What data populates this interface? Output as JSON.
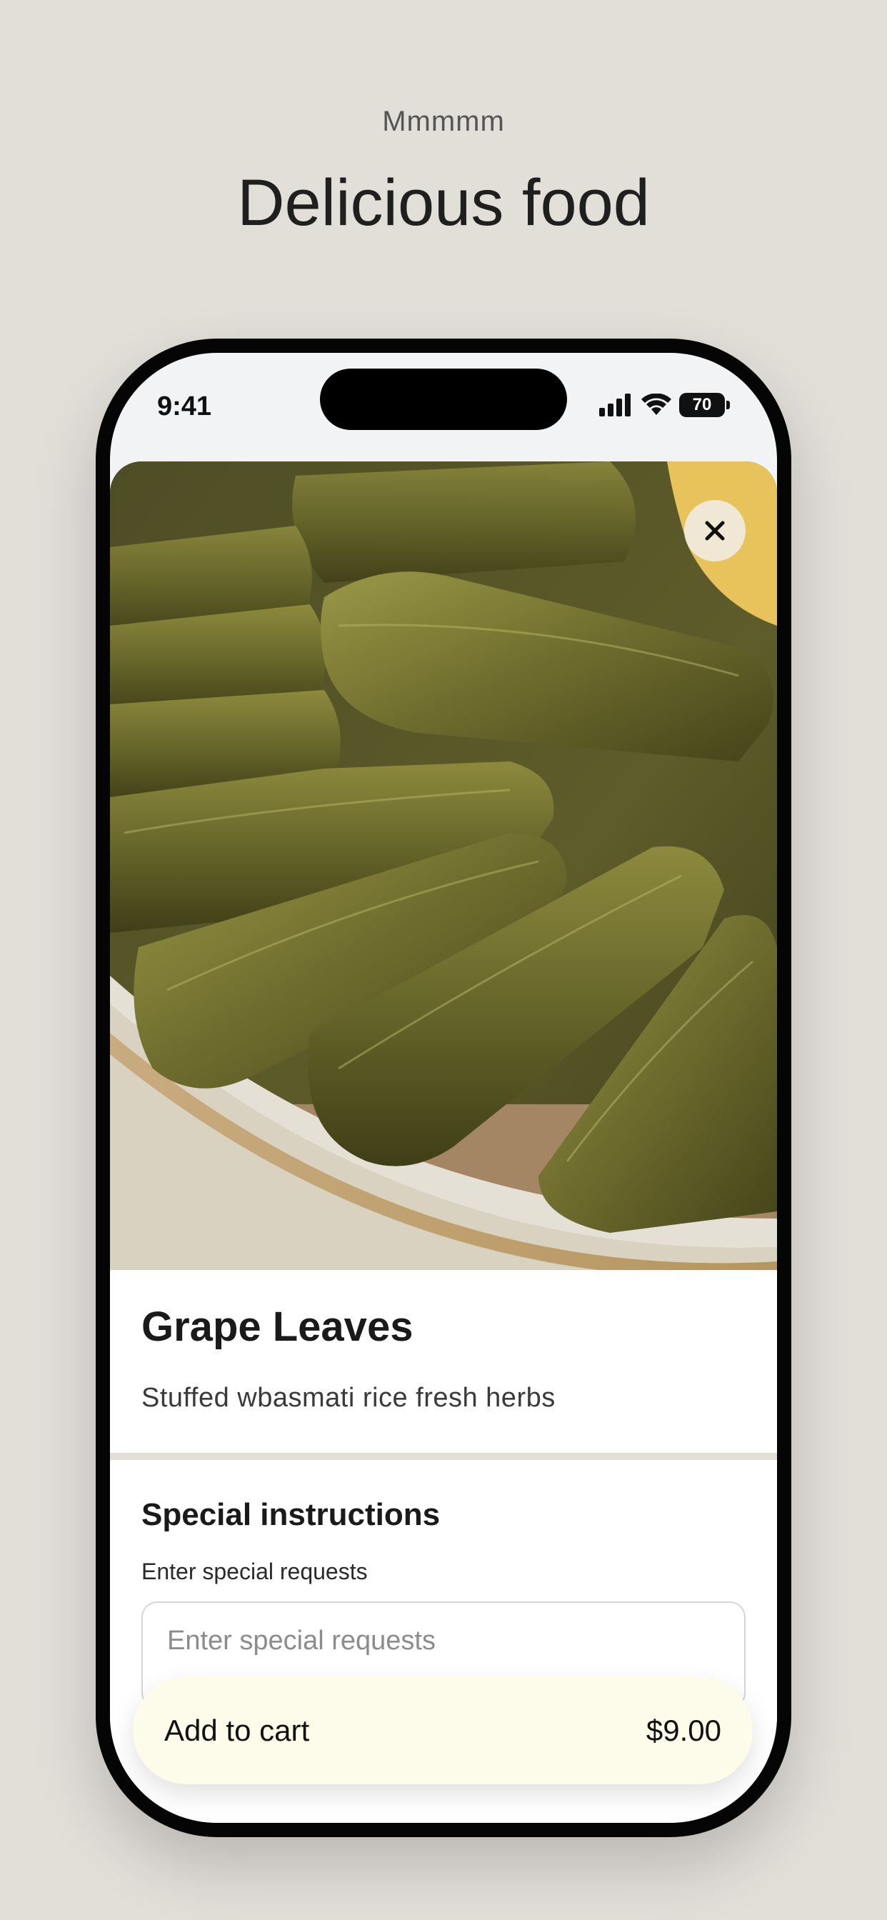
{
  "page": {
    "eyebrow": "Mmmmm",
    "headline": "Delicious food"
  },
  "status_bar": {
    "time": "9:41",
    "battery_level": "70",
    "icons": [
      "signal-icon",
      "wifi-icon",
      "battery-icon"
    ]
  },
  "item": {
    "image_icon": "food-photo",
    "close_icon": "close-icon",
    "title": "Grape Leaves",
    "description": "Stuffed wbasmati rice fresh herbs"
  },
  "special_instructions": {
    "title": "Special instructions",
    "label": "Enter special requests",
    "placeholder": "Enter special requests",
    "value": ""
  },
  "cart": {
    "label": "Add to cart",
    "price": "$9.00"
  },
  "colors": {
    "background": "#e2dfd9",
    "cart_button": "#fdfbe9",
    "phone_frame": "#050505"
  }
}
